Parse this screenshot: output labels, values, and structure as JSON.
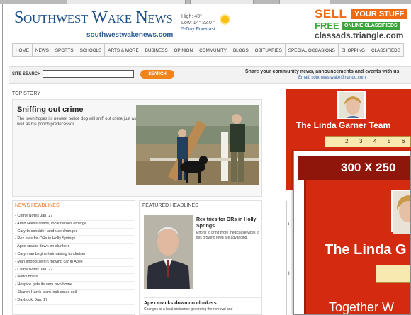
{
  "header": {
    "logo": "Southwest Wake News",
    "logo_url": "southwestwakenews.com",
    "weather": {
      "high": "High: 43°",
      "low": "Low:  14° 22.0 °",
      "forecast_link": "5-Day Forecast"
    }
  },
  "top_ad": {
    "sell": "SELL",
    "your_stuff": "YOUR STUFF",
    "free": "FREE",
    "online": "ONLINE CLASSIFIEDS",
    "site": "classads.triangle.com"
  },
  "nav": {
    "items": [
      "HOME",
      "NEWS",
      "SPORTS",
      "SCHOOLS",
      "ARTS & MORE",
      "BUSINESS",
      "OPINION",
      "COMMUNITY",
      "BLOGS",
      "OBITUARIES",
      "SPECIAL OCCASIONS",
      "SHOPPING",
      "CLASSIFIEDS"
    ]
  },
  "search": {
    "label": "SITE SEARCH",
    "value": "",
    "button": "SEARCH",
    "share_text": "Share your community news, announcements and events with us.",
    "share_email": "Email: southwestwake@nando.com"
  },
  "top_story": {
    "section": "TOP STORY",
    "headline": "Sniffing out crime",
    "summary": "The town hopes its newest police dog will sniff out crime just as well as his pooch predecessor."
  },
  "news_headlines": {
    "title": "NEWS HEADLINES",
    "items": [
      "- Crime Notes Jan. 27",
      "- Amid Haiti's chaos, local heroes emerge",
      "- Cary to consider land-use changes",
      "- Rex tries for ORs in Holly Springs",
      "- Apex cracks down on clunkers",
      "- Cary man begins hair-raising fundraiser",
      "- Man shoots self in moving car in Apex",
      "- Crime Notes Jan. 27",
      "- News briefs",
      "- Hospice gets its very own home",
      "- Sharon Harris plant leak sours soil",
      "- Daybook: Jan. 17"
    ]
  },
  "featured": {
    "title": "FEATURED HEADLINES",
    "story1_headline": "Rex tries for ORs in Holly Springs",
    "story1_text": "Efforts to bring more medical services to this growing town are advancing.",
    "story2_headline": "Apex cracks down on clunkers",
    "story2_text": "Changes to a local ordinance governing the removal and"
  },
  "right_ad": {
    "name": "The Linda Garner Team",
    "ruler_numbers": [
      "2",
      "3",
      "4",
      "5",
      "6"
    ]
  },
  "popup_ad": {
    "size": "300 X 250",
    "name": "The Linda G",
    "footer": "Together W"
  },
  "colors": {
    "brand_blue": "#1d4f8a",
    "accent_orange": "#f06a14",
    "ad_red": "#d42b10",
    "ad_green": "#3aa63a"
  }
}
